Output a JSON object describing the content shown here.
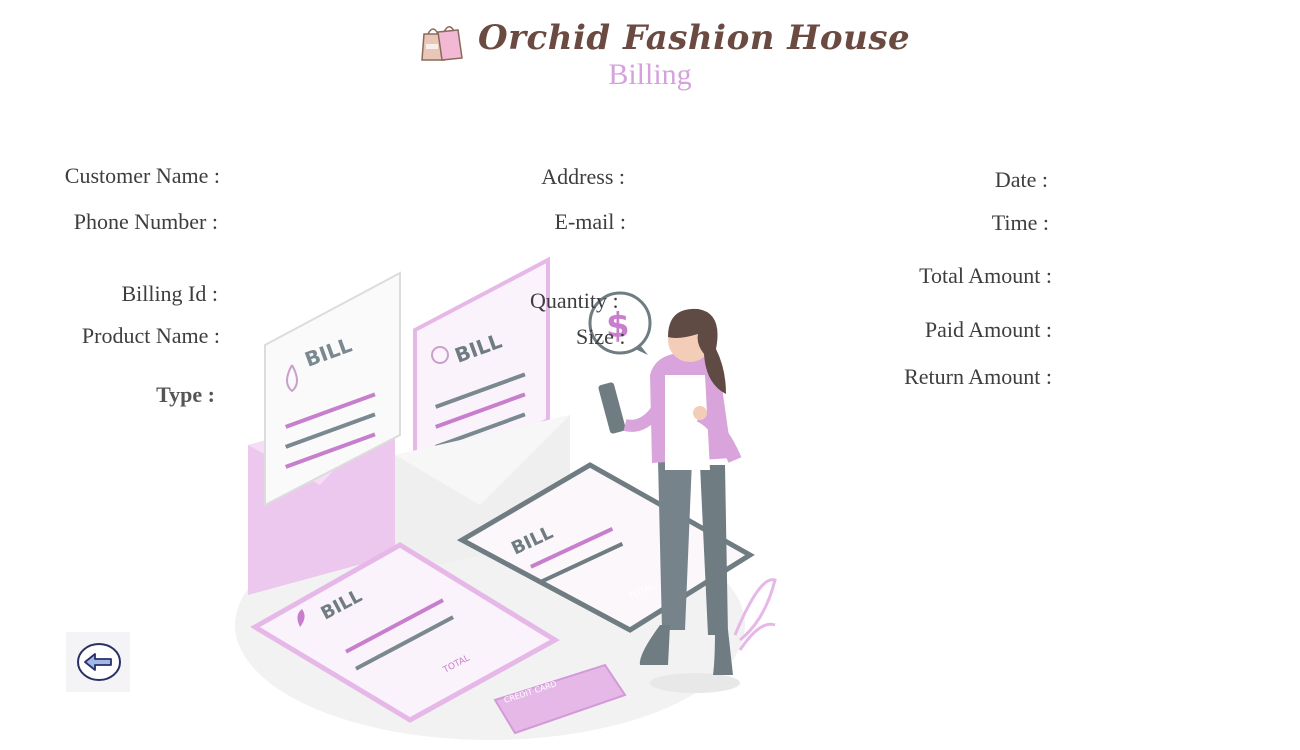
{
  "header": {
    "title": "Orchid Fashion House",
    "subtitle": "Billing",
    "icon": "shopping-bags-icon"
  },
  "fields": {
    "customer_name": "Customer Name :",
    "phone_number": "Phone Number :",
    "billing_id": "Billing  Id :",
    "product_name": "Product Name :",
    "type": "Type :",
    "address": "Address :",
    "email": "E-mail :",
    "quantity": "Quantity :",
    "size": "Size :",
    "date": "Date :",
    "time": "Time :",
    "total_amount": "Total Amount :",
    "paid_amount": "Paid Amount :",
    "return_amount": "Return Amount :"
  },
  "illustration": {
    "bill_text": "BILL",
    "total_text": "TOTAL",
    "credit_card_text": "CREDIT CARD",
    "dollar_symbol": "$"
  },
  "back_button": {
    "icon": "back-arrow-icon"
  },
  "colors": {
    "accent": "#d6a2dd",
    "brand": "#6b4a42",
    "pink": "#e6b8e8",
    "pink_dark": "#c77fcd",
    "gray": "#6f7c82"
  }
}
